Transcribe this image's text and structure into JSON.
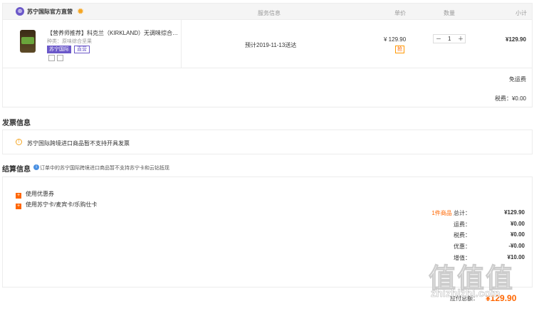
{
  "store": {
    "name": "苏宁国际官方直营"
  },
  "columns": {
    "service": "服务信息",
    "unit_price": "单价",
    "quantity": "数量",
    "subtotal": "小计"
  },
  "item": {
    "title": "【营养师推荐】科克兰（KIRKLAND）无调味综合…",
    "spec": "种类：原味综合坚果",
    "tags": [
      "苏宁国际",
      "直营"
    ],
    "delivery": "预计2019-11-13送达",
    "price": "¥ 129.90",
    "price_tag": "抢",
    "quantity": "1",
    "minus": "－",
    "plus": "＋",
    "subtotal": "¥129.90"
  },
  "shipping": {
    "free": "免运费",
    "tax": "税费：¥0.00"
  },
  "invoice": {
    "title": "发票信息",
    "notice": "苏宁国际跨境进口商品暂不支持开具发票"
  },
  "settle": {
    "title": "结算信息",
    "note": "订单中的苏宁国际跨境进口商品暂不支持苏宁卡和云钻抵现"
  },
  "options": [
    "使用优惠券",
    "使用苏宁卡/麦宾卡/乐购仕卡"
  ],
  "summary": [
    {
      "label_hl": "1件商品",
      "label": "总计：",
      "value": "¥129.90"
    },
    {
      "label": "运费：",
      "value": "¥0.00"
    },
    {
      "label": "税费：",
      "value": "¥0.00"
    },
    {
      "label": "优惠：",
      "value": "-¥0.00"
    },
    {
      "label": "增值：",
      "value": "¥10.00"
    }
  ],
  "total": {
    "label": "应付总额：",
    "value": "¥129.90"
  },
  "watermark": {
    "main": "值值值",
    "site": "zhizhizhi.com"
  },
  "colors": {
    "accent": "#ff6600",
    "brand": "#6b58c9"
  }
}
